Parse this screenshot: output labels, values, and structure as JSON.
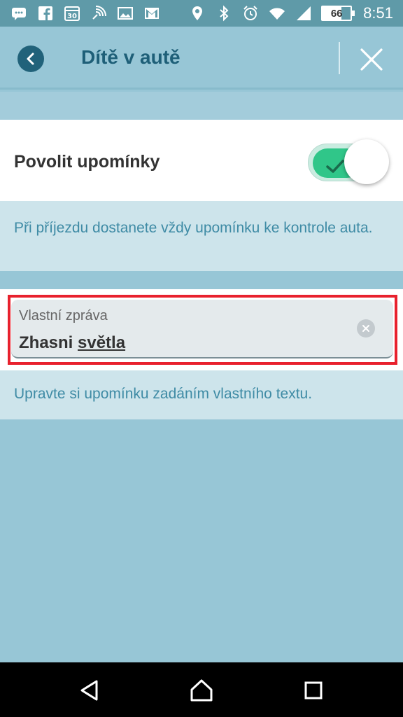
{
  "status_bar": {
    "time": "8:51",
    "battery_percent": "66",
    "left_icons": [
      "chat-icon",
      "facebook-icon",
      "calendar-icon",
      "nfc-icon",
      "gallery-icon",
      "gmail-icon"
    ],
    "right_icons": [
      "location-icon",
      "bluetooth-icon",
      "alarm-icon",
      "wifi-icon",
      "signal-icon",
      "battery-icon"
    ]
  },
  "header": {
    "title": "Dítě v autě"
  },
  "reminder_toggle": {
    "label": "Povolit upomínky",
    "enabled": true,
    "accent_color": "#30c689"
  },
  "info_arrival": {
    "text": "Při příjezdu dostanete vždy upomínku ke kontrole auta."
  },
  "custom_message": {
    "label": "Vlastní zpráva",
    "value_part1": "Zhasni ",
    "value_part2": "světla",
    "highlight_color": "#e8212d"
  },
  "info_custom": {
    "text": "Upravte si upomínku zadáním vlastního textu."
  },
  "colors": {
    "header_bg": "#97c6d6",
    "title_text": "#1e5f78",
    "info_text": "#3f8ba5"
  }
}
